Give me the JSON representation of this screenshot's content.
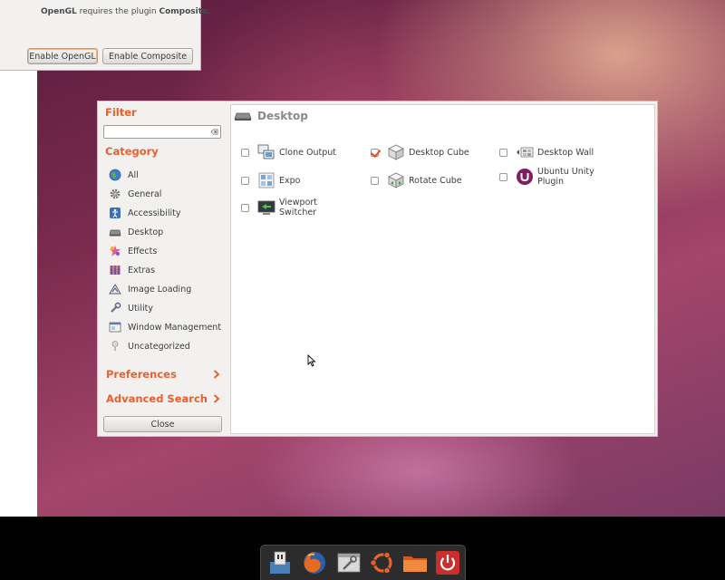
{
  "notice": {
    "message_bold_1": "OpenGL",
    "message_text": " requires the plugin ",
    "message_bold_2": "Composite.",
    "enable_opengl": "Enable OpenGL",
    "enable_composite": "Enable Composite"
  },
  "sidebar": {
    "filter_label": "Filter",
    "filter_value": "",
    "category_label": "Category",
    "categories": [
      {
        "label": "All",
        "icon": "globe-icon"
      },
      {
        "label": "General",
        "icon": "gear-icon"
      },
      {
        "label": "Accessibility",
        "icon": "accessibility-icon"
      },
      {
        "label": "Desktop",
        "icon": "desktop-icon"
      },
      {
        "label": "Effects",
        "icon": "effects-icon"
      },
      {
        "label": "Extras",
        "icon": "extras-icon"
      },
      {
        "label": "Image Loading",
        "icon": "image-loading-icon"
      },
      {
        "label": "Utility",
        "icon": "utility-icon"
      },
      {
        "label": "Window Management",
        "icon": "window-management-icon"
      },
      {
        "label": "Uncategorized",
        "icon": "uncategorized-icon"
      }
    ],
    "preferences": "Preferences",
    "advanced_search": "Advanced Search",
    "close": "Close"
  },
  "content": {
    "title": "Desktop",
    "plugins": [
      {
        "name": "Clone Output",
        "checked": false
      },
      {
        "name": "Desktop Cube",
        "checked": true
      },
      {
        "name": "Desktop Wall",
        "checked": false
      },
      {
        "name": "Expo",
        "checked": false
      },
      {
        "name": "Rotate Cube",
        "checked": false
      },
      {
        "name": "Ubuntu Unity Plugin",
        "checked": false
      },
      {
        "name": "Viewport Switcher",
        "checked": false
      }
    ]
  },
  "dock": {
    "items": [
      "ccsm-icon",
      "firefox-icon",
      "settings-icon",
      "ubuntu-icon",
      "folder-icon",
      "power-icon"
    ]
  },
  "colors": {
    "accent": "#e8612c",
    "dock": "#2c2c2c"
  }
}
